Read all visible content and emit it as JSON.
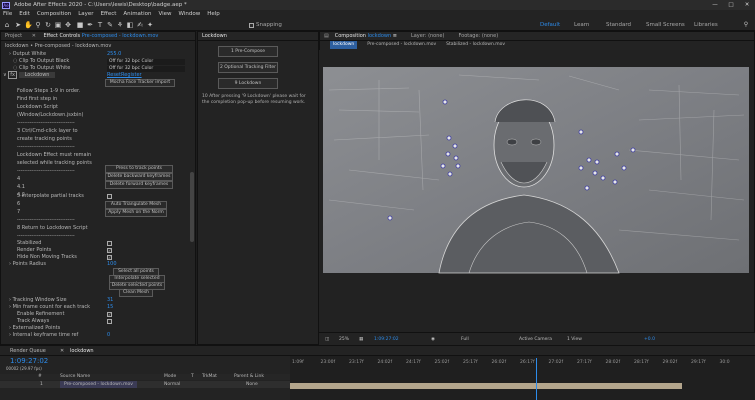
{
  "window": {
    "app_icon": "Ae",
    "title": "Adobe After Effects 2020 - C:\\Users\\lewis\\Desktop\\badge.aep *",
    "controls": [
      "—",
      "□",
      "✕"
    ]
  },
  "menu": [
    "File",
    "Edit",
    "Composition",
    "Layer",
    "Effect",
    "Animation",
    "View",
    "Window",
    "Help"
  ],
  "toolbar": {
    "snapping": "Snapping",
    "workspaces": [
      "Default",
      "Learn",
      "Standard",
      "Small Screens",
      "Libraries"
    ],
    "active_workspace": "Default",
    "search_icon": "search-icon"
  },
  "effect_controls": {
    "project_tab": "Project",
    "tab_label": "Effect Controls",
    "tab_layer": "Pre-composed - lockdown.mov",
    "subtitle": "lockdown • Pre-composed - lockdown.mov",
    "output_white_label": "Output White",
    "output_white_value": "255.0",
    "clip_black_label": "Clip To Output Black",
    "clip_black_value": "Off for 32 bpc Color",
    "clip_white_label": "Clip To Output White",
    "clip_white_value": "Off for 32 bpc Color",
    "fx_name": "Lockdown",
    "reset": "Reset",
    "register": "Register",
    "mocha_btn": "Mocha Face Tracker import",
    "lines": [
      "Follow Steps 1-9 in order.",
      "Find first step in",
      "Lockdown Script",
      "(Window/Lockdown.jsxbin)",
      "--------------------------------",
      "3 Ctrl/Cmd-click layer to",
      "create tracking points",
      "--------------------------------",
      "Lockdown Effect must remain",
      "selected while tracking points",
      "--------------------------------"
    ],
    "steps": [
      "4",
      "4.1",
      "4.2"
    ],
    "step_btns": [
      "Press to track points",
      "Delete backward keyframes",
      "Delete forward keyframes"
    ],
    "interpolate": "5 Interpolate partial tracks",
    "steps2": [
      "6",
      "7"
    ],
    "step_btns2": [
      "Auto Triangulate Mesh",
      "Apply Mesh on the Norm"
    ],
    "divider": "--------------------------------",
    "return_text": "8 Return to Lockdown Script",
    "divider2": "--------------------------------",
    "stabilized": "Stabilized",
    "render_points": "Render Points",
    "hide_nonmoving": "Hide Non Moving Tracks",
    "points_radius": "Points Radius",
    "points_radius_value": "100",
    "select_btns": [
      "Select all points",
      "Interpolate selected points",
      "Delete selected points",
      "Clean Mesh"
    ],
    "tracking_window": "Tracking Window Size",
    "tracking_window_value": "31",
    "min_frame": "Min frame count for each track",
    "min_frame_value": "15",
    "enable_refinement": "Enable Refinement",
    "track_always": "Track Always",
    "externalized": "Externalized Points",
    "internal_kf": "Internal keyframe time ref",
    "internal_kf_value": "0"
  },
  "lockdown_panel": {
    "title": "Lockdown",
    "buttons": [
      "1 Pre-Compose",
      "2 Optional Tracking Filter",
      "9 Lockdown"
    ],
    "note": "10 After pressing '9 Lockdown' please wait for the completion pop-up before resuming work."
  },
  "composition": {
    "tab": "Composition",
    "comp_name": "lockdown",
    "layer_tab": "Layer: (none)",
    "footage_tab": "Footage: (none)",
    "crumbs": [
      "lockdown",
      "Pre-composed - lockdown.mov",
      "Stabilized - lockdown.mov"
    ],
    "zoom": "25%",
    "timecode": "1:09:27:02",
    "quality": "Full",
    "camera": "Active Camera",
    "views": "1 View",
    "offset": "+0.0"
  },
  "timeline": {
    "render_queue": "Render Queue",
    "comp_tab": "lockdown",
    "timecode": "1:09:27:02",
    "frame_info": "00002 (29.97 fps)",
    "columns": [
      "#",
      "Source Name",
      "Mode",
      "T",
      "TrkMat",
      "Parent & Link"
    ],
    "layer": {
      "num": "1",
      "name": "Pre-composed - lockdown.mov",
      "mode": "Normal",
      "parent": "None"
    },
    "ticks": [
      "1:09f",
      "23:00f",
      "23:17f",
      "24:02f",
      "24:17f",
      "25:02f",
      "25:17f",
      "26:02f",
      "26:17f",
      "27:02f",
      "27:17f",
      "28:02f",
      "28:17f",
      "29:02f",
      "29:17f",
      "30:0"
    ],
    "playhead_fraction": 0.53
  }
}
